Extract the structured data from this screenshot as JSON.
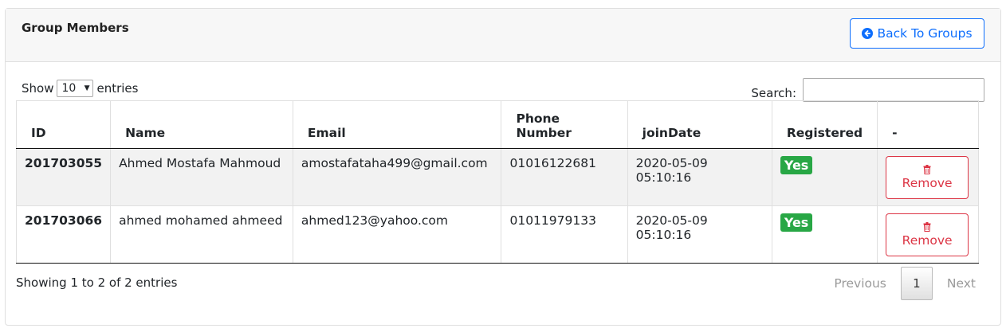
{
  "header": {
    "title": "Group Members",
    "back_label": "Back To Groups"
  },
  "controls": {
    "show_label": "Show",
    "length_value": "10",
    "entries_label": "entries",
    "search_label": "Search:",
    "search_value": ""
  },
  "table": {
    "columns": [
      "ID",
      "Name",
      "Email",
      "Phone Number",
      "joinDate",
      "Registered",
      "-"
    ],
    "rows": [
      {
        "id": "201703055",
        "name": "Ahmed Mostafa Mahmoud",
        "email": "amostafataha499@gmail.com",
        "phone": "01016122681",
        "join_date": "2020-05-09 05:10:16",
        "registered": "Yes",
        "action": "Remove"
      },
      {
        "id": "201703066",
        "name": "ahmed mohamed ahmeed",
        "email": "ahmed123@yahoo.com",
        "phone": "01011979133",
        "join_date": "2020-05-09 05:10:16",
        "registered": "Yes",
        "action": "Remove"
      }
    ]
  },
  "footer": {
    "info": "Showing 1 to 2 of 2 entries",
    "previous": "Previous",
    "current_page": "1",
    "next": "Next"
  },
  "colors": {
    "primary": "#0d6efd",
    "success": "#28a745",
    "danger": "#dc3545"
  },
  "icons": {
    "back": "circle-arrow-left-icon",
    "remove": "trash-icon"
  }
}
